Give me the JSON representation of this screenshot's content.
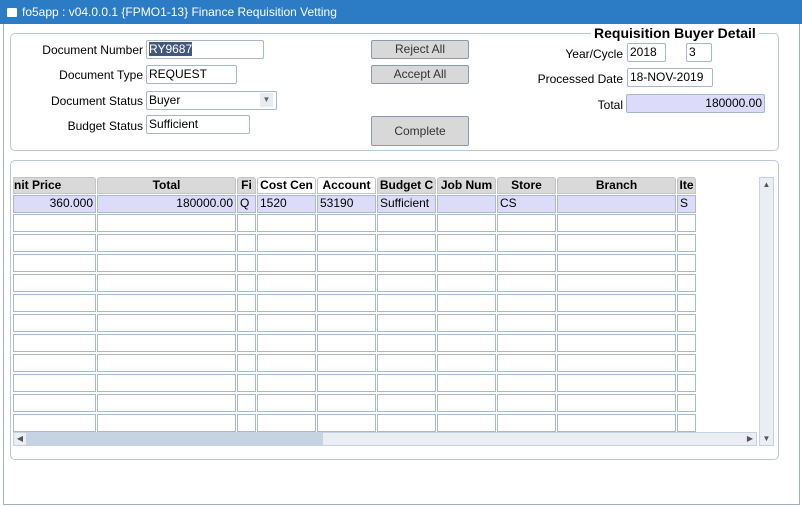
{
  "window": {
    "title": "fo5app : v04.0.0.1  {FPMO1-13} Finance Requisition Vetting"
  },
  "header": {
    "document_number_label": "Document Number",
    "document_number": "RY9687",
    "document_type_label": "Document Type",
    "document_type": "REQUEST",
    "document_status_label": "Document Status",
    "document_status": "Buyer",
    "budget_status_label": "Budget Status",
    "budget_status": "Sufficient",
    "reject_all": "Reject All",
    "accept_all": "Accept All",
    "complete": "Complete"
  },
  "buyer_detail": {
    "title": "Requisition Buyer Detail",
    "year_cycle_label": "Year/Cycle",
    "year": "2018",
    "cycle": "3",
    "processed_date_label": "Processed Date",
    "processed_date": "18-NOV-2019",
    "total_label": "Total",
    "total": "180000.00"
  },
  "grid": {
    "columns": [
      {
        "label": "nit Price",
        "align": "right"
      },
      {
        "label": "Total",
        "align": "right"
      },
      {
        "label": "Fi",
        "align": "left"
      },
      {
        "label": "Cost Cen",
        "align": "left",
        "highlight": true
      },
      {
        "label": "Account",
        "align": "left",
        "highlight": true
      },
      {
        "label": "Budget C",
        "align": "left"
      },
      {
        "label": "Job Num",
        "align": "left"
      },
      {
        "label": "Store",
        "align": "left"
      },
      {
        "label": "Branch",
        "align": "left"
      },
      {
        "label": "Ite",
        "align": "left"
      }
    ],
    "rows": [
      [
        "360.000",
        "180000.00",
        "Q",
        "1520",
        "53190",
        "Sufficient",
        "",
        "CS",
        "",
        "S"
      ],
      [],
      [],
      [],
      [],
      [],
      [],
      [],
      [],
      [],
      [],
      []
    ]
  }
}
